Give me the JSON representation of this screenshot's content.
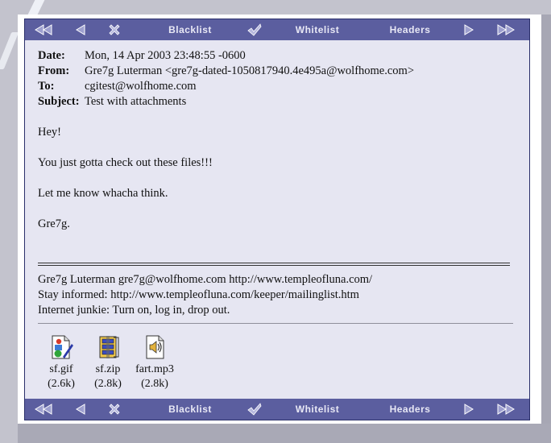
{
  "nav": {
    "blacklist": "Blacklist",
    "whitelist": "Whitelist",
    "headers": "Headers"
  },
  "email": {
    "headers": [
      {
        "key": "Date:",
        "value": "Mon, 14 Apr 2003 23:48:55 -0600"
      },
      {
        "key": "From:",
        "value": "Gre7g Luterman <gre7g-dated-1050817940.4e495a@wolfhome.com>"
      },
      {
        "key": "To:",
        "value": "cgitest@wolfhome.com"
      },
      {
        "key": "Subject:",
        "value": "Test with attachments"
      }
    ],
    "body": [
      "Hey!",
      "You just gotta check out these files!!!",
      "Let me know whacha think.",
      "Gre7g."
    ],
    "signature": [
      "Gre7g Luterman gre7g@wolfhome.com http://www.templeofluna.com/",
      "Stay informed: http://www.templeofluna.com/keeper/mailinglist.htm",
      "Internet junkie: Turn on, log in, drop out."
    ]
  },
  "attachments": [
    {
      "name": "sf.gif",
      "size": "(2.6k)",
      "icon": "image-file-icon"
    },
    {
      "name": "sf.zip",
      "size": "(2.8k)",
      "icon": "archive-file-icon"
    },
    {
      "name": "fart.mp3",
      "size": "(2.8k)",
      "icon": "audio-file-icon"
    }
  ],
  "colors": {
    "navbar": "#5b5e9f",
    "frame_bg": "#e6e6f2",
    "page_bg": "#b9b9c4"
  }
}
